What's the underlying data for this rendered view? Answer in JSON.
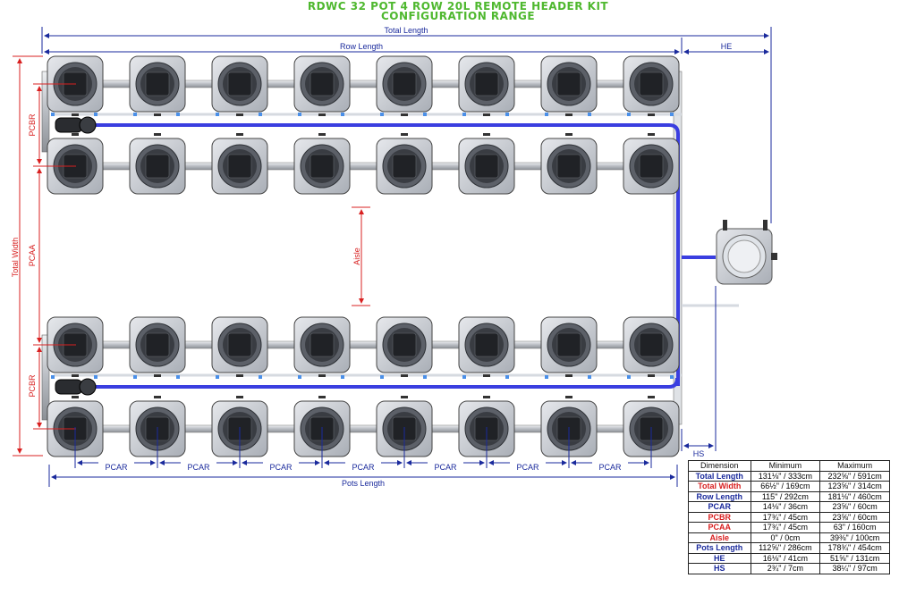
{
  "title": {
    "line1": "RDWC 32 POT 4 ROW 20L REMOTE HEADER KIT",
    "line2": "CONFIGURATION RANGE"
  },
  "labels": {
    "total_length": "Total Length",
    "row_length": "Row Length",
    "he": "HE",
    "hs": "HS",
    "total_width": "Total Width",
    "pcbr": "PCBR",
    "pcaa": "PCAA",
    "aisle": "Aisle",
    "pcar": "PCAR",
    "pots_length": "Pots Length"
  },
  "table": {
    "headers": [
      "Dimension",
      "Minimum",
      "Maximum"
    ],
    "rows": [
      {
        "name": "Total Length",
        "min": "131⅛\" / 333cm",
        "max": "232⅝\" / 591cm",
        "color": "#1a2a9c"
      },
      {
        "name": "Total Width",
        "min": "66½\" / 169cm",
        "max": "123⅝\" / 314cm",
        "color": "#d82020"
      },
      {
        "name": "Row Length",
        "min": "115\" / 292cm",
        "max": "181⅛\" / 460cm",
        "color": "#1a2a9c"
      },
      {
        "name": "PCAR",
        "min": "14⅛\" / 36cm",
        "max": "23⅝\" / 60cm",
        "color": "#1a2a9c"
      },
      {
        "name": "PCBR",
        "min": "17¾\" / 45cm",
        "max": "23⅝\" / 60cm",
        "color": "#d82020"
      },
      {
        "name": "PCAA",
        "min": "17¾\" / 45cm",
        "max": "63\" / 160cm",
        "color": "#d82020"
      },
      {
        "name": "Aisle",
        "min": "0\" / 0cm",
        "max": "39⅜\" / 100cm",
        "color": "#d82020"
      },
      {
        "name": "Pots Length",
        "min": "112⅝\" / 286cm",
        "max": "178¾\" / 454cm",
        "color": "#1a2a9c"
      },
      {
        "name": "HE",
        "min": "16⅛\" / 41cm",
        "max": "51⅝\" / 131cm",
        "color": "#1a2a9c"
      },
      {
        "name": "HS",
        "min": "2¾\" / 7cm",
        "max": "38¼\" / 97cm",
        "color": "#1a2a9c"
      }
    ]
  },
  "colors": {
    "title": "#4fb82f",
    "horizontal_dim": "#1a2a9c",
    "vertical_dim": "#d82020",
    "pipe_blue": "#3a3ee0",
    "pot_body": "#c8ccd2"
  }
}
